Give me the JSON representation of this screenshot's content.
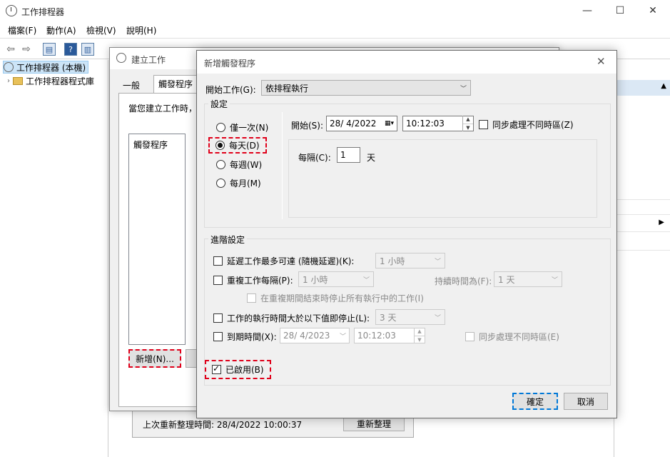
{
  "main_window": {
    "title": "工作排程器",
    "controls": {
      "minimize": "—",
      "maximize": "☐",
      "close": "✕"
    },
    "menu": [
      "檔案(F)",
      "動作(A)",
      "檢視(V)",
      "說明(H)"
    ],
    "tree": [
      {
        "label": "工作排程器 (本機)"
      },
      {
        "label": "工作排程器程式庫"
      }
    ],
    "status": {
      "last_refresh": "上次重新整理時間: 28/4/2022 10:00:37",
      "refresh_button": "重新整理"
    }
  },
  "create_task_dialog": {
    "title": "建立工作",
    "tabs": [
      "一般",
      "觸發程序"
    ],
    "active_tab": "觸發程序",
    "description": "當您建立工作時，",
    "list_header": "觸發程序",
    "new_button": "新增(N)..."
  },
  "new_trigger_dialog": {
    "title": "新增觸發程序",
    "close": "✕",
    "begin_task_label": "開始工作(G):",
    "begin_task_value": "依排程執行",
    "settings_group": "設定",
    "schedule_options": [
      "僅一次(N)",
      "每天(D)",
      "每週(W)",
      "每月(M)"
    ],
    "selected_schedule": "每天(D)",
    "start_label": "開始(S):",
    "start_date": "28/ 4/2022",
    "start_time": "10:12:03",
    "sync_timezone": "同步處理不同時區(Z)",
    "recur_label": "每隔(C):",
    "recur_value": "1",
    "recur_unit": "天",
    "advanced_group": "進階設定",
    "delay_label": "延遲工作最多可達 (隨機延遲)(K):",
    "delay_value": "1 小時",
    "repeat_label": "重複工作每隔(P):",
    "repeat_value": "1 小時",
    "duration_label": "持續時間為(F):",
    "duration_value": "1 天",
    "stop_at_end_label": "在重複期間結束時停止所有執行中的工作(I)",
    "stop_longer_label": "工作的執行時間大於以下值即停止(L):",
    "stop_longer_value": "3 天",
    "expire_label": "到期時間(X):",
    "expire_date": "28/  4/2023",
    "expire_time": "10:12:03",
    "expire_sync": "同步處理不同時區(E)",
    "enabled_label": "已啟用(B)",
    "enabled": true,
    "ok_button": "確定",
    "cancel_button": "取消"
  }
}
